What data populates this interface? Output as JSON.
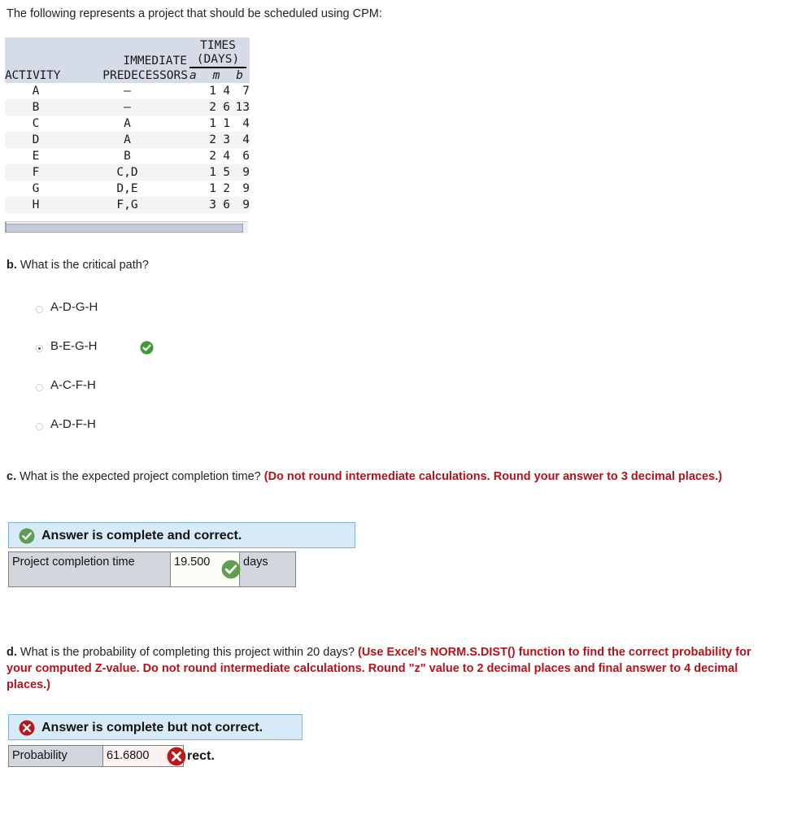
{
  "intro": "The following represents a project that should be scheduled using CPM:",
  "cpm_table": {
    "header": {
      "activity": "ACTIVITY",
      "immediate": "IMMEDIATE",
      "predecessors": "PREDECESSORS",
      "times": "TIMES",
      "days": "(DAYS)",
      "a": "a",
      "m": "m",
      "b": "b"
    },
    "rows": [
      {
        "activity": "A",
        "predecessors": "—",
        "a": "1",
        "m": "4",
        "b": "7"
      },
      {
        "activity": "B",
        "predecessors": "—",
        "a": "2",
        "m": "6",
        "b": "13"
      },
      {
        "activity": "C",
        "predecessors": "A",
        "a": "1",
        "m": "1",
        "b": "4"
      },
      {
        "activity": "D",
        "predecessors": "A",
        "a": "2",
        "m": "3",
        "b": "4"
      },
      {
        "activity": "E",
        "predecessors": "B",
        "a": "2",
        "m": "4",
        "b": "6"
      },
      {
        "activity": "F",
        "predecessors": "C,D",
        "a": "1",
        "m": "5",
        "b": "9"
      },
      {
        "activity": "G",
        "predecessors": "D,E",
        "a": "1",
        "m": "2",
        "b": "9"
      },
      {
        "activity": "H",
        "predecessors": "F,G",
        "a": "3",
        "m": "6",
        "b": "9"
      }
    ]
  },
  "question_b": {
    "letter": "b.",
    "text": "What is the critical path?",
    "choices": [
      {
        "label": "A-D-G-H",
        "selected": false,
        "marked_correct": false
      },
      {
        "label": "B-E-G-H",
        "selected": true,
        "marked_correct": true
      },
      {
        "label": "A-C-F-H",
        "selected": false,
        "marked_correct": false
      },
      {
        "label": "A-D-F-H",
        "selected": false,
        "marked_correct": false
      }
    ]
  },
  "question_c": {
    "letter": "c.",
    "text": "What is the expected project completion time?",
    "hint": "(Do not round intermediate calculations. Round your answer to 3 decimal places.)",
    "banner": "Answer is complete and correct.",
    "row_label": "Project completion time",
    "value": "19.500",
    "unit": "days"
  },
  "question_d": {
    "letter": "d.",
    "text": "What is the probability of completing this project within 20 days?",
    "hint": "(Use Excel's NORM.S.DIST() function to find the correct probability for your computed Z-value. Do not round intermediate calculations. Round \"z\" value to 2 decimal places and final answer to 4 decimal places.)",
    "banner": "Answer is complete but not correct.",
    "banner_overflow": "rect.",
    "row_label": "Probability",
    "value": "61.6800"
  },
  "colors": {
    "banner_bg": "#d6eaf7",
    "banner_border": "#7fb3d5",
    "header_bg": "#d5dce8",
    "hint_red": "#b5121b",
    "correct_green": "#5f9e4f",
    "incorrect_red": "#b8191c",
    "cell_label_bg": "#d2d6dd"
  }
}
